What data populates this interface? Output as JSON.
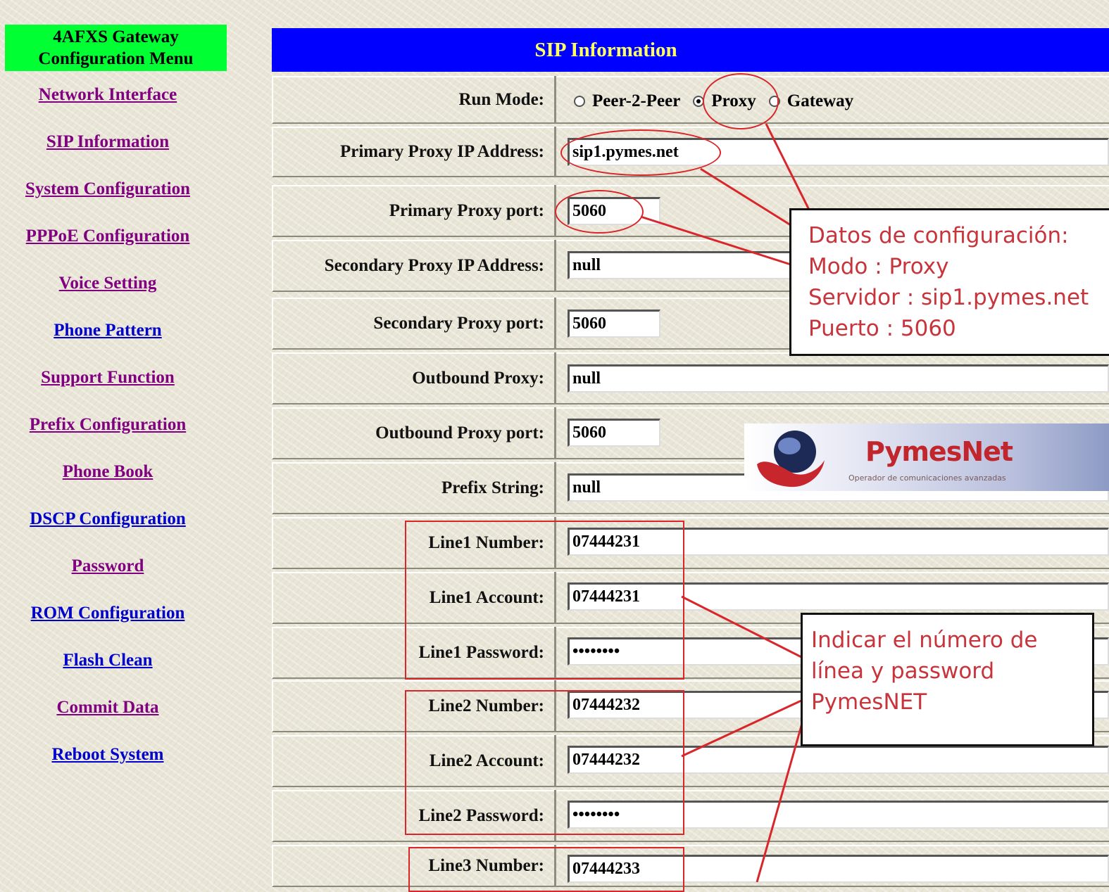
{
  "sidebar": {
    "header_line1": "4AFXS Gateway",
    "header_line2": "Configuration Menu",
    "items": [
      {
        "label": "Network Interface"
      },
      {
        "label": "SIP Information"
      },
      {
        "label": "System Configuration"
      },
      {
        "label": "PPPoE Configuration"
      },
      {
        "label": "Voice Setting"
      },
      {
        "label": "Phone Pattern"
      },
      {
        "label": "Support Function"
      },
      {
        "label": "Prefix Configuration"
      },
      {
        "label": "Phone Book"
      },
      {
        "label": "DSCP Configuration"
      },
      {
        "label": "Password"
      },
      {
        "label": "ROM Configuration"
      },
      {
        "label": "Flash Clean"
      },
      {
        "label": "Commit Data"
      },
      {
        "label": "Reboot System"
      }
    ]
  },
  "main": {
    "title": "SIP Information",
    "run_mode": {
      "label": "Run Mode:",
      "options": [
        "Peer-2-Peer",
        "Proxy",
        "Gateway"
      ],
      "selected": "Proxy"
    },
    "fields": {
      "primary_proxy_ip": {
        "label": "Primary Proxy IP Address:",
        "value": "sip1.pymes.net"
      },
      "primary_proxy_port": {
        "label": "Primary Proxy port:",
        "value": "5060"
      },
      "secondary_proxy_ip": {
        "label": "Secondary Proxy IP Address:",
        "value": "null"
      },
      "secondary_proxy_port": {
        "label": "Secondary Proxy port:",
        "value": "5060"
      },
      "outbound_proxy": {
        "label": "Outbound Proxy:",
        "value": "null"
      },
      "outbound_proxy_port": {
        "label": "Outbound Proxy port:",
        "value": "5060"
      },
      "prefix_string": {
        "label": "Prefix String:",
        "value": "null"
      },
      "line1_number": {
        "label": "Line1 Number:",
        "value": "07444231"
      },
      "line1_account": {
        "label": "Line1 Account:",
        "value": "07444231"
      },
      "line1_password": {
        "label": "Line1 Password:",
        "value": "••••••••"
      },
      "line2_number": {
        "label": "Line2 Number:",
        "value": "07444232"
      },
      "line2_account": {
        "label": "Line2 Account:",
        "value": "07444232"
      },
      "line2_password": {
        "label": "Line2 Password:",
        "value": "••••••••"
      },
      "line3_number": {
        "label": "Line3 Number:",
        "value": "07444233"
      }
    }
  },
  "annotations": {
    "note1": [
      "Datos de configuración:",
      "Modo : Proxy",
      "Servidor : sip1.pymes.net",
      "Puerto : 5060"
    ],
    "note2": [
      "Indicar el número de",
      "línea y password",
      "PymesNET"
    ],
    "accent_color": "#d9262a"
  },
  "logo": {
    "name": "PymesNet",
    "tagline": "Operador de comunicaciones avanzadas"
  }
}
